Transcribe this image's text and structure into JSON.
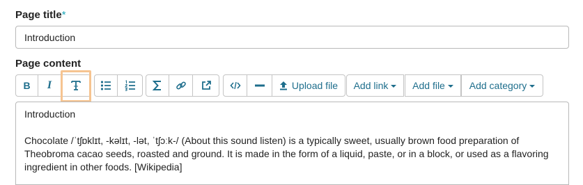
{
  "page_title": {
    "label": "Page title",
    "required_mark": "*",
    "value": "Introduction"
  },
  "page_content": {
    "label": "Page content",
    "toolbar": {
      "bold_label": "B",
      "italic_label": "I",
      "upload_file_label": "Upload file",
      "add_link_label": "Add link",
      "add_file_label": "Add file",
      "add_category_label": "Add category"
    },
    "editor": {
      "heading": "Introduction",
      "paragraph": "Chocolate /ˈtʃɒklɪt, -kəlɪt, -lət, ˈtʃɔːk-/ (About this sound listen) is a typically sweet, usually brown food preparation of Theobroma cacao seeds, roasted and ground. It is made in the form of a liquid, paste, or in a block, or used as a flavoring ingredient in other foods. [Wikipedia]"
    }
  },
  "colors": {
    "accent": "#1e6e8c",
    "required": "#1aa5b8",
    "highlight": "#f6c491"
  }
}
